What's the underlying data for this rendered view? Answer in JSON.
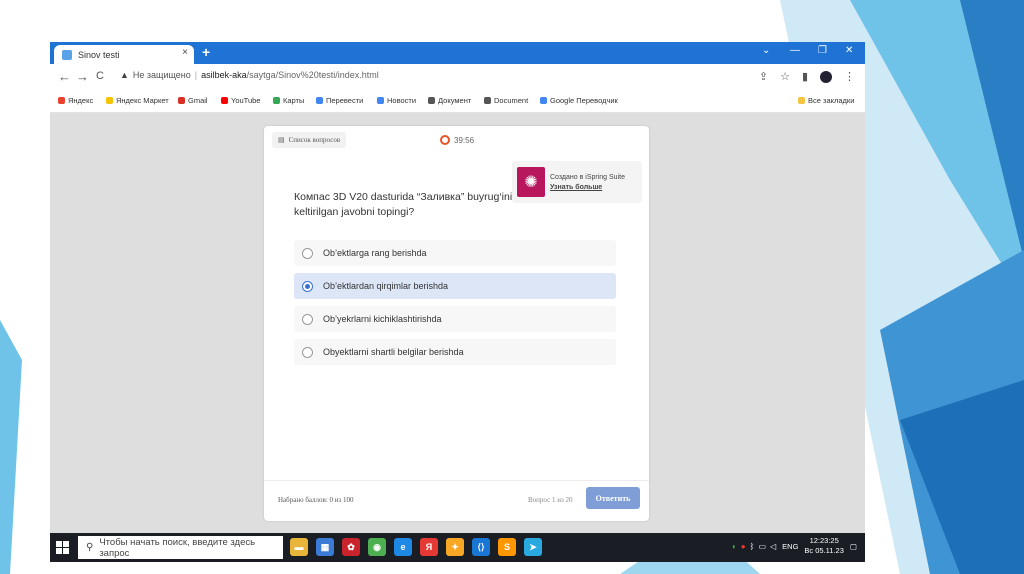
{
  "browser": {
    "tab_title": "Sinov testi",
    "tab_close": "×",
    "new_tab": "+",
    "window_controls": [
      "⌄",
      "—",
      "❐",
      "✕"
    ],
    "nav": {
      "back": "←",
      "forward": "→",
      "reload": "C"
    },
    "security_warning": "Не защищено",
    "url_domain": "asilbek-aka",
    "url_path": "/saytga/Sinov%20testi/index.html",
    "bookmarks": [
      {
        "label": "Яндекс",
        "icon": "yandex-icon",
        "color": "#e8412c"
      },
      {
        "label": "Яндекс Маркет",
        "icon": "market-icon",
        "color": "#f5c400"
      },
      {
        "label": "Gmail",
        "icon": "gmail-icon",
        "color": "#d93025"
      },
      {
        "label": "YouTube",
        "icon": "youtube-icon",
        "color": "#ff0000"
      },
      {
        "label": "Карты",
        "icon": "maps-icon",
        "color": "#34a853"
      },
      {
        "label": "Перевести",
        "icon": "translate-icon",
        "color": "#4285f4"
      },
      {
        "label": "Новости",
        "icon": "news-icon",
        "color": "#4285f4"
      },
      {
        "label": "Документ",
        "icon": "document-icon",
        "color": "#555555"
      },
      {
        "label": "Document",
        "icon": "document-icon",
        "color": "#555555"
      },
      {
        "label": "Google Переводчик",
        "icon": "translate-icon",
        "color": "#4285f4"
      }
    ],
    "all_bookmarks": "Все закладки"
  },
  "quiz": {
    "question_list_label": "Список вопросов",
    "timer": "39:56",
    "ispring_title": "Создано в iSpring Suite",
    "ispring_link": "Узнать больше",
    "question": "Компас 3D V20 dasturida  “Заливка” buyrug‘ining ... keltirilgan javobni topingi?",
    "answers": [
      {
        "text": "Ob’ektlarga rang berishda",
        "selected": false
      },
      {
        "text": "Ob’ektlardan qirqimlar berishda",
        "selected": true
      },
      {
        "text": "Ob’yekrlarni kichiklashtirishda",
        "selected": false
      },
      {
        "text": "Obyektlarni shartli belgilar berishda",
        "selected": false
      }
    ],
    "score": "Набрано баллов: 0 из 100",
    "question_number": "Вопрос 1 из 20",
    "submit_label": "Ответить"
  },
  "taskbar": {
    "search_placeholder": "Чтобы начать поиск, введите здесь запрос",
    "apps": [
      {
        "name": "explorer-icon",
        "color": "#e8b53a",
        "glyph": "▬"
      },
      {
        "name": "store-icon",
        "color": "#3a7bd5",
        "glyph": "▦"
      },
      {
        "name": "huawei-icon",
        "color": "#c9242b",
        "glyph": "✿"
      },
      {
        "name": "chrome-icon",
        "color": "#4caf50",
        "glyph": "◉"
      },
      {
        "name": "edge-icon",
        "color": "#1e88e5",
        "glyph": "e"
      },
      {
        "name": "yandex-browser-icon",
        "color": "#e53935",
        "glyph": "Я"
      },
      {
        "name": "app-icon",
        "color": "#f9a825",
        "glyph": "✦"
      },
      {
        "name": "vscode-icon",
        "color": "#1976d2",
        "glyph": "⟨⟩"
      },
      {
        "name": "sublime-icon",
        "color": "#ff9800",
        "glyph": "S"
      },
      {
        "name": "telegram-icon",
        "color": "#29a9e0",
        "glyph": "➤"
      }
    ],
    "language": "ENG",
    "time": "12:23:25",
    "date": "Вс 05.11.23"
  }
}
